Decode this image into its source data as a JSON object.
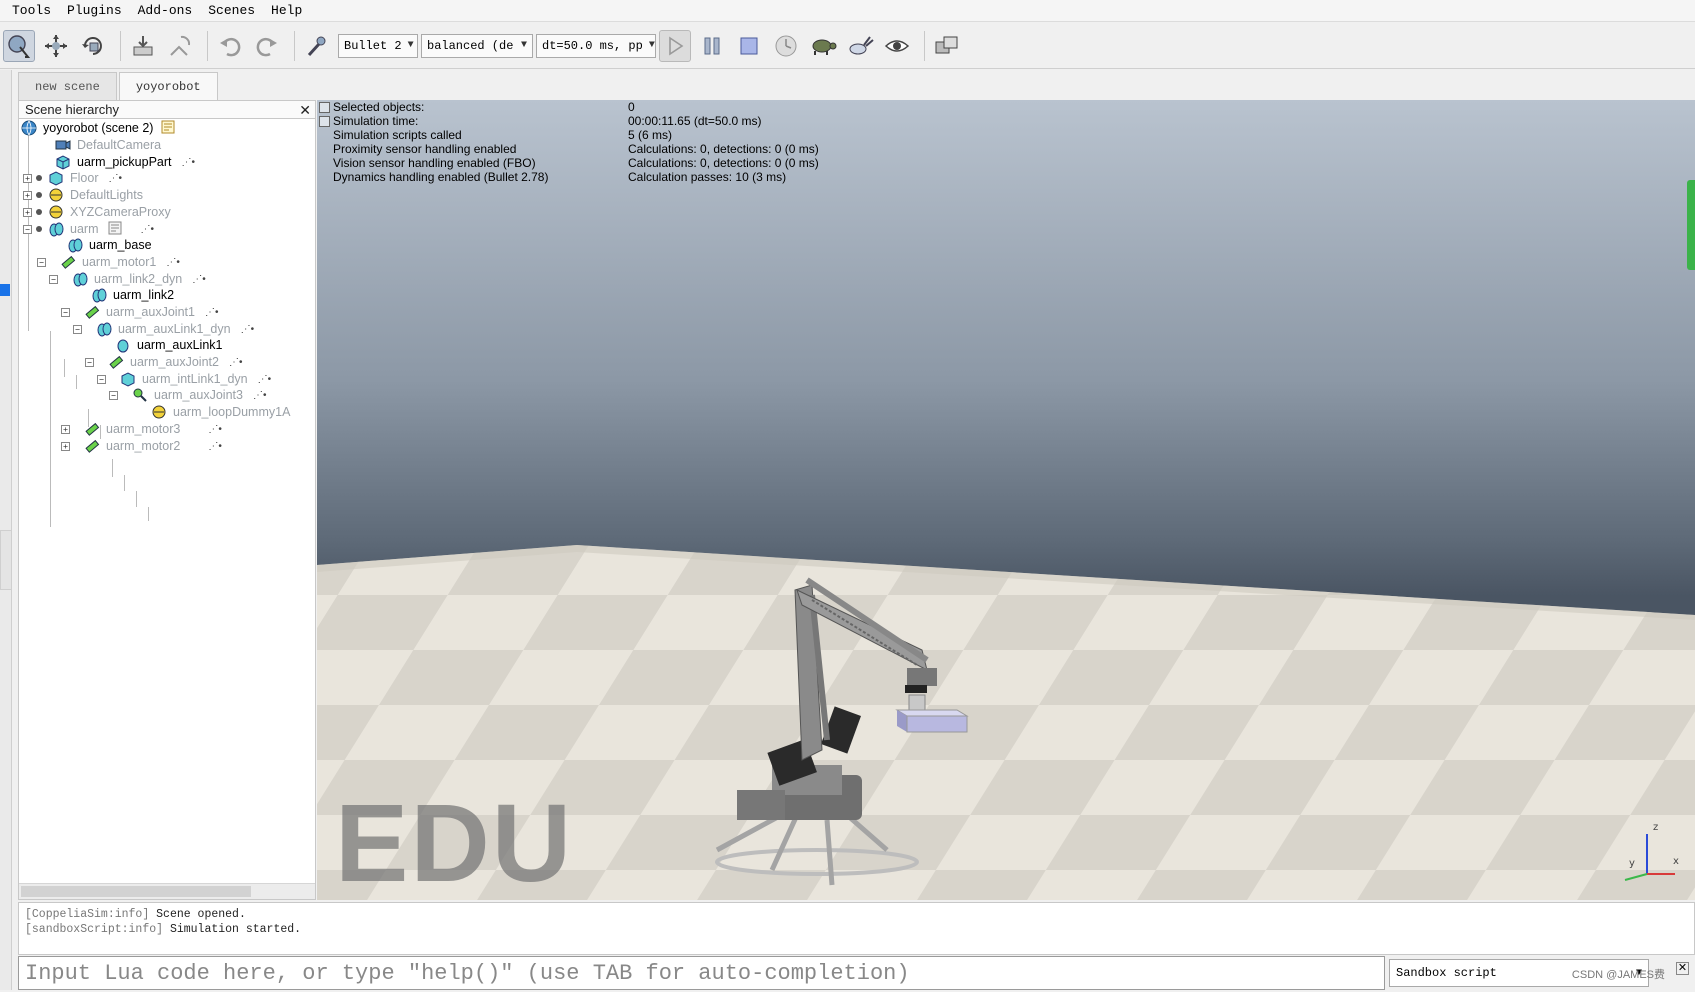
{
  "menu": [
    "Tools",
    "Plugins",
    "Add-ons",
    "Scenes",
    "Help"
  ],
  "toolbar": {
    "engine": "Bullet 2",
    "accuracy": "balanced (de",
    "timestep": "dt=50.0 ms, pp"
  },
  "tabs": [
    "new scene",
    "yoyorobot"
  ],
  "hierarchy": {
    "title": "Scene hierarchy",
    "items": [
      {
        "label": "yoyorobot (scene 2)"
      },
      {
        "label": "DefaultCamera"
      },
      {
        "label": "uarm_pickupPart"
      },
      {
        "label": "Floor"
      },
      {
        "label": "DefaultLights"
      },
      {
        "label": "XYZCameraProxy"
      },
      {
        "label": "uarm"
      },
      {
        "label": "uarm_base"
      },
      {
        "label": "uarm_motor1"
      },
      {
        "label": "uarm_link2_dyn"
      },
      {
        "label": "uarm_link2"
      },
      {
        "label": "uarm_auxJoint1"
      },
      {
        "label": "uarm_auxLink1_dyn"
      },
      {
        "label": "uarm_auxLink1"
      },
      {
        "label": "uarm_auxJoint2"
      },
      {
        "label": "uarm_intLink1_dyn"
      },
      {
        "label": "uarm_auxJoint3"
      },
      {
        "label": "uarm_loopDummy1A"
      },
      {
        "label": "uarm_motor3"
      },
      {
        "label": "uarm_motor2"
      }
    ]
  },
  "info": {
    "rows": [
      {
        "label": "Selected objects:",
        "value": "0"
      },
      {
        "label": "Simulation time:",
        "value": "00:00:11.65 (dt=50.0 ms)"
      },
      {
        "label": "Simulation scripts called",
        "value": "5 (6 ms)"
      },
      {
        "label": "Proximity sensor handling enabled",
        "value": "Calculations: 0, detections: 0 (0 ms)"
      },
      {
        "label": "Vision sensor handling enabled (FBO)",
        "value": "Calculations: 0, detections: 0 (0 ms)"
      },
      {
        "label": "Dynamics handling enabled (Bullet 2.78)",
        "value": "Calculation passes: 10 (3 ms)"
      }
    ]
  },
  "viewport": {
    "watermark": "EDU",
    "axis_labels": {
      "z": "z",
      "y": "y",
      "x": "x"
    }
  },
  "console": {
    "lines": [
      {
        "tag": "[CoppeliaSim:info]",
        "text": "Scene  opened."
      },
      {
        "tag": "[sandboxScript:info]",
        "text": "Simulation  started."
      }
    ]
  },
  "lua": {
    "placeholder": "Input Lua code here, or type \"help()\" (use TAB for auto-completion)",
    "script_target": "Sandbox script"
  },
  "footer": {
    "credit": "CSDN @JAMES费"
  },
  "colors": {
    "accent": "#1a73e8",
    "indicator": "#3bb34a"
  }
}
